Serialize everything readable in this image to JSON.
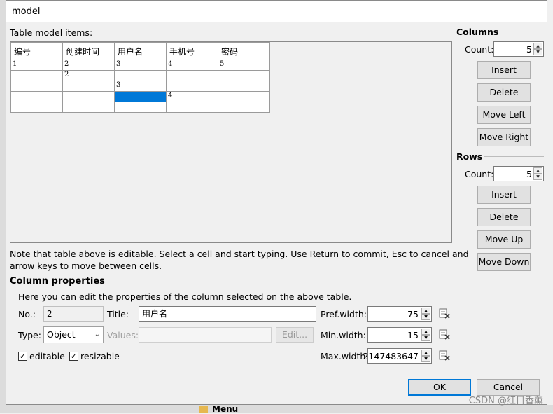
{
  "window": {
    "title": "model"
  },
  "table": {
    "label": "Table model items:",
    "headers": [
      "编号",
      "创建时间",
      "用户名",
      "手机号",
      "密码"
    ],
    "rows": [
      [
        "1",
        "2",
        "3",
        "4",
        "5"
      ],
      [
        "",
        "2",
        "",
        "",
        ""
      ],
      [
        "",
        "",
        "3",
        "",
        ""
      ],
      [
        "",
        "",
        "",
        "4",
        ""
      ],
      [
        "",
        "",
        "",
        "",
        ""
      ]
    ]
  },
  "columns_group": {
    "title": "Columns",
    "count_label": "Count:",
    "count": "5",
    "buttons": {
      "insert": "Insert",
      "delete": "Delete",
      "move_left": "Move Left",
      "move_right": "Move Right"
    }
  },
  "rows_group": {
    "title": "Rows",
    "count_label": "Count:",
    "count": "5",
    "buttons": {
      "insert": "Insert",
      "delete": "Delete",
      "move_up": "Move Up",
      "move_down": "Move Down"
    }
  },
  "note": {
    "line1": "Note that table above is editable. Select a cell and start typing. Use Return to commit, Esc to cancel and",
    "line2": "arrow keys to move between cells."
  },
  "column_properties": {
    "title": "Column properties",
    "description": "Here you can edit the properties of the column selected on the above table.",
    "no_label": "No.:",
    "no_value": "2",
    "title_label": "Title:",
    "title_value": "用户名",
    "pref_width_label": "Pref.width:",
    "pref_width": "75",
    "type_label": "Type:",
    "type_value": "Object",
    "values_label": "Values:",
    "values_value": "",
    "edit_button": "Edit...",
    "min_width_label": "Min.width:",
    "min_width": "15",
    "editable_label": "editable",
    "resizable_label": "resizable",
    "max_width_label": "Max.width:",
    "max_width": "2147483647"
  },
  "dialog_buttons": {
    "ok": "OK",
    "cancel": "Cancel"
  },
  "background": {
    "menu_label": "Menu",
    "watermark": "CSDN @红目香薰"
  },
  "icons": [
    "reset-default-icon",
    "spin-up-icon",
    "spin-down-icon",
    "checkbox-checked-icon",
    "combo-chevron-icon"
  ]
}
